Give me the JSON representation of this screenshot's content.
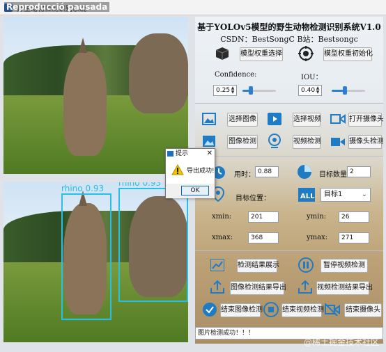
{
  "window": {
    "title": "野生动物检测识别系统",
    "overlay_text": "Reproducció pausada"
  },
  "top_image": {
    "alt_description": ""
  },
  "bottom_image": {
    "detections": [
      {
        "label": "rhino",
        "score": "0.93"
      },
      {
        "label": "rhino",
        "score": "0.93"
      }
    ]
  },
  "header": {
    "title": "基于YOLOv5模型的野生动物检测识别系统V1.0",
    "subtitle": "CSDN：BestSongC   B站：Bestsongc"
  },
  "model": {
    "select_weights_label": "模型权重选择",
    "init_weights_label": "模型权重初始化"
  },
  "params": {
    "confidence_label": "Confidence:",
    "confidence_value": "0.25",
    "confidence_level": 0.25,
    "iou_label": "IOU：",
    "iou_value": "0.40",
    "iou_level": 0.4
  },
  "actions": {
    "select_image": "选择图像",
    "select_video": "选择视频",
    "open_camera": "打开摄像头",
    "image_detect": "图像检测",
    "video_detect": "视频检测",
    "camera_detect": "摄像头检测"
  },
  "results": {
    "time_label": "用时：",
    "time_value": "0.88",
    "count_label": "目标数量：",
    "count_value": "2",
    "position_label": "目标位置：",
    "target_select_value": "目标1",
    "xmin_label": "xmin:",
    "xmin_value": "201",
    "ymin_label": "ymin:",
    "ymin_value": "26",
    "xmax_label": "xmax:",
    "xmax_value": "368",
    "ymax_label": "ymax:",
    "ymax_value": "271"
  },
  "bottom_actions": {
    "show_results": "检测结果展示",
    "pause_video": "暂停视频检测",
    "export_image": "图像检测结果导出",
    "export_video": "视频检测结果导出",
    "end_image": "结束图像检测",
    "end_video": "结束视频检测",
    "end_camera": "结束摄像头"
  },
  "status": {
    "message": "图片检测成功！！！"
  },
  "watermark": "@稀土掘金技术社区",
  "dialog": {
    "title": "提示",
    "message": "导出成功!",
    "ok_label": "OK",
    "close_label": "✕"
  },
  "colors": {
    "accent_blue": "#2f7fd0",
    "detection_cyan": "#26c0e6"
  }
}
